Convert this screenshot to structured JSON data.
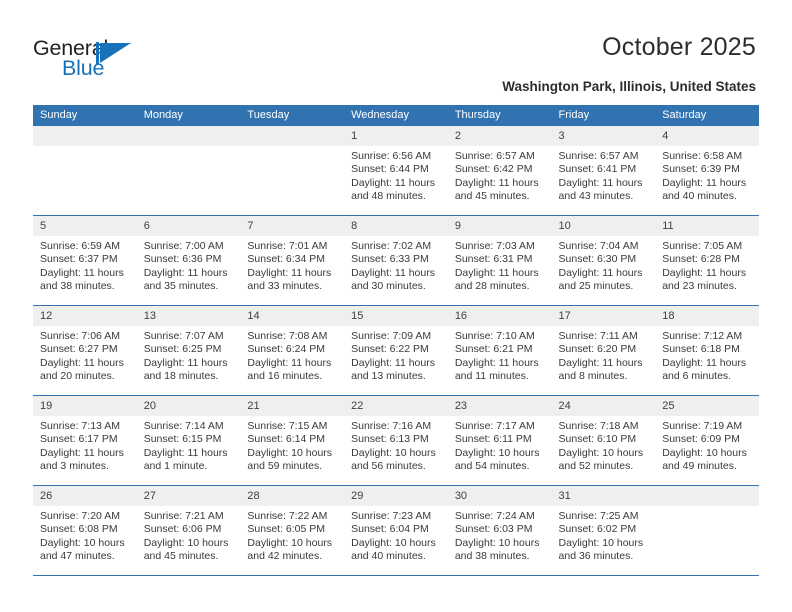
{
  "brand": {
    "name_dark": "General",
    "name_blue": "Blue",
    "logo_icon": "blue-flag-triangle-icon",
    "accent_color": "#1673bb"
  },
  "header": {
    "title": "October 2025",
    "location": "Washington Park, Illinois, United States"
  },
  "calendar": {
    "header_bg": "#3172b0",
    "daynum_bg": "#efefef",
    "weekday_headers": [
      "Sunday",
      "Monday",
      "Tuesday",
      "Wednesday",
      "Thursday",
      "Friday",
      "Saturday"
    ],
    "labels": {
      "sunrise": "Sunrise:",
      "sunset": "Sunset:",
      "daylight": "Daylight:"
    },
    "weeks": [
      [
        {
          "day": "",
          "blank": true
        },
        {
          "day": "",
          "blank": true
        },
        {
          "day": "",
          "blank": true
        },
        {
          "day": "1",
          "sunrise": "Sunrise: 6:56 AM",
          "sunset": "Sunset: 6:44 PM",
          "daylight": "Daylight: 11 hours and 48 minutes."
        },
        {
          "day": "2",
          "sunrise": "Sunrise: 6:57 AM",
          "sunset": "Sunset: 6:42 PM",
          "daylight": "Daylight: 11 hours and 45 minutes."
        },
        {
          "day": "3",
          "sunrise": "Sunrise: 6:57 AM",
          "sunset": "Sunset: 6:41 PM",
          "daylight": "Daylight: 11 hours and 43 minutes."
        },
        {
          "day": "4",
          "sunrise": "Sunrise: 6:58 AM",
          "sunset": "Sunset: 6:39 PM",
          "daylight": "Daylight: 11 hours and 40 minutes."
        }
      ],
      [
        {
          "day": "5",
          "sunrise": "Sunrise: 6:59 AM",
          "sunset": "Sunset: 6:37 PM",
          "daylight": "Daylight: 11 hours and 38 minutes."
        },
        {
          "day": "6",
          "sunrise": "Sunrise: 7:00 AM",
          "sunset": "Sunset: 6:36 PM",
          "daylight": "Daylight: 11 hours and 35 minutes."
        },
        {
          "day": "7",
          "sunrise": "Sunrise: 7:01 AM",
          "sunset": "Sunset: 6:34 PM",
          "daylight": "Daylight: 11 hours and 33 minutes."
        },
        {
          "day": "8",
          "sunrise": "Sunrise: 7:02 AM",
          "sunset": "Sunset: 6:33 PM",
          "daylight": "Daylight: 11 hours and 30 minutes."
        },
        {
          "day": "9",
          "sunrise": "Sunrise: 7:03 AM",
          "sunset": "Sunset: 6:31 PM",
          "daylight": "Daylight: 11 hours and 28 minutes."
        },
        {
          "day": "10",
          "sunrise": "Sunrise: 7:04 AM",
          "sunset": "Sunset: 6:30 PM",
          "daylight": "Daylight: 11 hours and 25 minutes."
        },
        {
          "day": "11",
          "sunrise": "Sunrise: 7:05 AM",
          "sunset": "Sunset: 6:28 PM",
          "daylight": "Daylight: 11 hours and 23 minutes."
        }
      ],
      [
        {
          "day": "12",
          "sunrise": "Sunrise: 7:06 AM",
          "sunset": "Sunset: 6:27 PM",
          "daylight": "Daylight: 11 hours and 20 minutes."
        },
        {
          "day": "13",
          "sunrise": "Sunrise: 7:07 AM",
          "sunset": "Sunset: 6:25 PM",
          "daylight": "Daylight: 11 hours and 18 minutes."
        },
        {
          "day": "14",
          "sunrise": "Sunrise: 7:08 AM",
          "sunset": "Sunset: 6:24 PM",
          "daylight": "Daylight: 11 hours and 16 minutes."
        },
        {
          "day": "15",
          "sunrise": "Sunrise: 7:09 AM",
          "sunset": "Sunset: 6:22 PM",
          "daylight": "Daylight: 11 hours and 13 minutes."
        },
        {
          "day": "16",
          "sunrise": "Sunrise: 7:10 AM",
          "sunset": "Sunset: 6:21 PM",
          "daylight": "Daylight: 11 hours and 11 minutes."
        },
        {
          "day": "17",
          "sunrise": "Sunrise: 7:11 AM",
          "sunset": "Sunset: 6:20 PM",
          "daylight": "Daylight: 11 hours and 8 minutes."
        },
        {
          "day": "18",
          "sunrise": "Sunrise: 7:12 AM",
          "sunset": "Sunset: 6:18 PM",
          "daylight": "Daylight: 11 hours and 6 minutes."
        }
      ],
      [
        {
          "day": "19",
          "sunrise": "Sunrise: 7:13 AM",
          "sunset": "Sunset: 6:17 PM",
          "daylight": "Daylight: 11 hours and 3 minutes."
        },
        {
          "day": "20",
          "sunrise": "Sunrise: 7:14 AM",
          "sunset": "Sunset: 6:15 PM",
          "daylight": "Daylight: 11 hours and 1 minute."
        },
        {
          "day": "21",
          "sunrise": "Sunrise: 7:15 AM",
          "sunset": "Sunset: 6:14 PM",
          "daylight": "Daylight: 10 hours and 59 minutes."
        },
        {
          "day": "22",
          "sunrise": "Sunrise: 7:16 AM",
          "sunset": "Sunset: 6:13 PM",
          "daylight": "Daylight: 10 hours and 56 minutes."
        },
        {
          "day": "23",
          "sunrise": "Sunrise: 7:17 AM",
          "sunset": "Sunset: 6:11 PM",
          "daylight": "Daylight: 10 hours and 54 minutes."
        },
        {
          "day": "24",
          "sunrise": "Sunrise: 7:18 AM",
          "sunset": "Sunset: 6:10 PM",
          "daylight": "Daylight: 10 hours and 52 minutes."
        },
        {
          "day": "25",
          "sunrise": "Sunrise: 7:19 AM",
          "sunset": "Sunset: 6:09 PM",
          "daylight": "Daylight: 10 hours and 49 minutes."
        }
      ],
      [
        {
          "day": "26",
          "sunrise": "Sunrise: 7:20 AM",
          "sunset": "Sunset: 6:08 PM",
          "daylight": "Daylight: 10 hours and 47 minutes."
        },
        {
          "day": "27",
          "sunrise": "Sunrise: 7:21 AM",
          "sunset": "Sunset: 6:06 PM",
          "daylight": "Daylight: 10 hours and 45 minutes."
        },
        {
          "day": "28",
          "sunrise": "Sunrise: 7:22 AM",
          "sunset": "Sunset: 6:05 PM",
          "daylight": "Daylight: 10 hours and 42 minutes."
        },
        {
          "day": "29",
          "sunrise": "Sunrise: 7:23 AM",
          "sunset": "Sunset: 6:04 PM",
          "daylight": "Daylight: 10 hours and 40 minutes."
        },
        {
          "day": "30",
          "sunrise": "Sunrise: 7:24 AM",
          "sunset": "Sunset: 6:03 PM",
          "daylight": "Daylight: 10 hours and 38 minutes."
        },
        {
          "day": "31",
          "sunrise": "Sunrise: 7:25 AM",
          "sunset": "Sunset: 6:02 PM",
          "daylight": "Daylight: 10 hours and 36 minutes."
        },
        {
          "day": "",
          "blank": true
        }
      ]
    ]
  }
}
